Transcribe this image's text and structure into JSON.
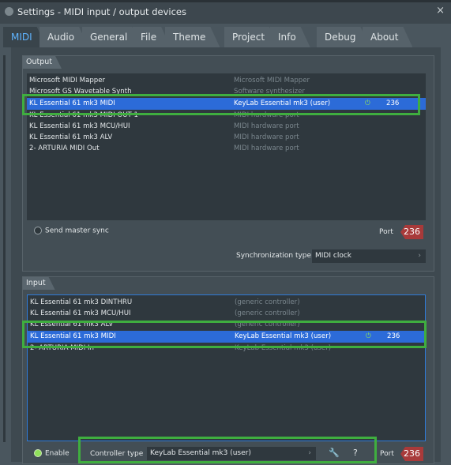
{
  "window": {
    "title": "Settings - MIDI input / output devices",
    "close_glyph": "×"
  },
  "tabs": [
    "MIDI",
    "Audio",
    "General",
    "File",
    "Theme",
    "Project",
    "Info",
    "Debug",
    "About"
  ],
  "output": {
    "label": "Output",
    "rows": [
      {
        "device": "Microsoft MIDI Mapper",
        "type": "Microsoft MIDI Mapper"
      },
      {
        "device": "Microsoft GS Wavetable Synth",
        "type": "Software synthesizer"
      },
      {
        "device": "KL Essential 61 mk3 MIDI",
        "type": "KeyLab Essential mk3 (user)",
        "power": "⏻",
        "port": "236"
      },
      {
        "device": "KL Essential 61 mk3 MIDI OUT 1",
        "type": "MIDI hardware port"
      },
      {
        "device": "KL Essential 61 mk3 MCU/HUI",
        "type": "MIDI hardware port"
      },
      {
        "device": "KL Essential 61 mk3 ALV",
        "type": "MIDI hardware port"
      },
      {
        "device": "2- ARTURIA MIDI Out",
        "type": "MIDI hardware port"
      }
    ],
    "send_master_sync": "Send master sync",
    "port_label": "Port",
    "port_value": "236",
    "sync_type_label": "Synchronization type",
    "sync_type_value": "MIDI clock",
    "dropdown_arrow": "›"
  },
  "input": {
    "label": "Input",
    "rows": [
      {
        "device": "KL Essential 61 mk3 DINTHRU",
        "type": "(generic controller)"
      },
      {
        "device": "KL Essential 61 mk3 MCU/HUI",
        "type": "(generic controller)"
      },
      {
        "device": "KL Essential 61 mk3 ALV",
        "type": "(generic controller)"
      },
      {
        "device": "KL Essential 61 mk3 MIDI",
        "type": "KeyLab Essential mk3 (user)",
        "power": "⏻",
        "port": "236"
      },
      {
        "device": "2- ARTURIA MIDI In",
        "type": "KeyLab Essential mk3 (user)"
      }
    ],
    "enable_label": "Enable",
    "controller_type_label": "Controller type",
    "controller_type_value": "KeyLab Essential mk3 (user)",
    "wrench_glyph": "🔧",
    "help_glyph": "?",
    "port_label": "Port",
    "port_value": "236"
  },
  "colors": {
    "accent_tab": "#5fb4ff",
    "selection": "#2c6bd8",
    "highlight_box": "#3fae3f",
    "port_badge": "#a83a3a",
    "power_on": "#8fe05b"
  }
}
